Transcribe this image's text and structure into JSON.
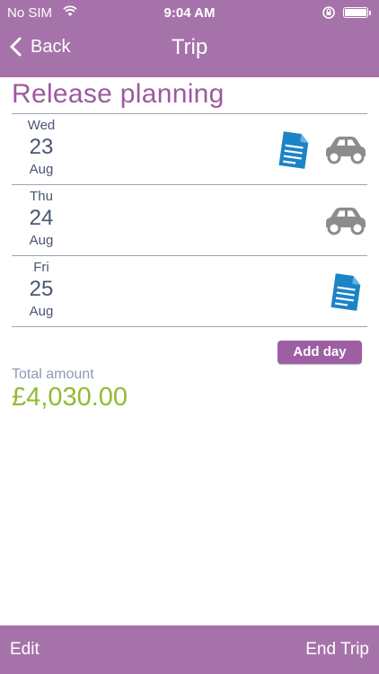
{
  "status_bar": {
    "carrier": "No SIM",
    "time": "9:04 AM"
  },
  "nav": {
    "back_label": "Back",
    "title": "Trip"
  },
  "trip": {
    "name": "Release planning",
    "days": [
      {
        "weekday": "Wed",
        "day": "23",
        "month": "Aug",
        "icons": [
          "document-icon",
          "car-icon"
        ]
      },
      {
        "weekday": "Thu",
        "day": "24",
        "month": "Aug",
        "icons": [
          "car-icon"
        ]
      },
      {
        "weekday": "Fri",
        "day": "25",
        "month": "Aug",
        "icons": [
          "document-icon"
        ]
      }
    ]
  },
  "actions": {
    "add_day_label": "Add day"
  },
  "total": {
    "label": "Total amount",
    "value": "£4,030.00"
  },
  "toolbar": {
    "edit_label": "Edit",
    "end_trip_label": "End Trip"
  },
  "colors": {
    "bar": "#a573a9",
    "title": "#9b5aa0",
    "date_text": "#4a5572",
    "document_icon": "#1c83c6",
    "car_icon": "#8c8c8c",
    "total_value": "#93ba35",
    "button": "#9e5ea3"
  }
}
